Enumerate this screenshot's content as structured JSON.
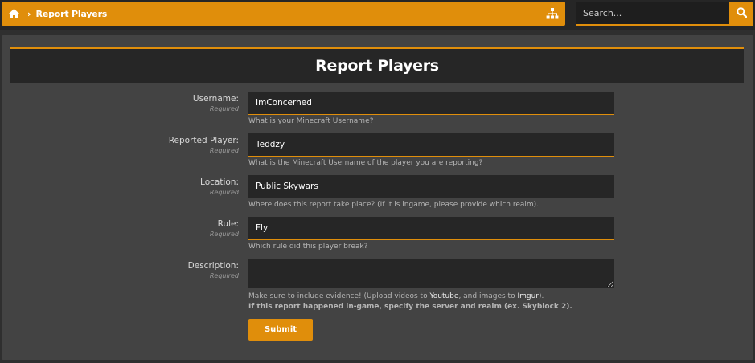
{
  "breadcrumb": {
    "home_icon": "home-icon",
    "chevron_icon": "chevron-right-icon",
    "current": "Report Players",
    "sitemap_icon": "sitemap-icon"
  },
  "search": {
    "placeholder": "Search...",
    "button_icon": "search-icon"
  },
  "form": {
    "title": "Report Players",
    "fields": [
      {
        "label": "Username:",
        "required": "Required",
        "value": "ImConcerned",
        "hint": "What is your Minecraft Username?"
      },
      {
        "label": "Reported Player:",
        "required": "Required",
        "value": "Teddzy",
        "hint": "What is the Minecraft Username of the player you are reporting?"
      },
      {
        "label": "Location:",
        "required": "Required",
        "value": "Public Skywars",
        "hint": "Where does this report take place? (If it is ingame, please provide which realm)."
      },
      {
        "label": "Rule:",
        "required": "Required",
        "value": "Fly",
        "hint": "Which rule did this player break?"
      },
      {
        "label": "Description:",
        "required": "Required",
        "value": "",
        "hint_parts": {
          "before": "Make sure to include evidence! (Upload videos to ",
          "link1": "Youtube",
          "middle": ", and images to ",
          "link2": "Imgur",
          "after": ")."
        },
        "hint2": "If this report happened in-game, specify the server and realm (ex. Skyblock 2)."
      }
    ],
    "submit_label": "Submit"
  },
  "colors": {
    "accent": "#e08e0b",
    "panel": "#434343",
    "field_bg": "#262626"
  }
}
